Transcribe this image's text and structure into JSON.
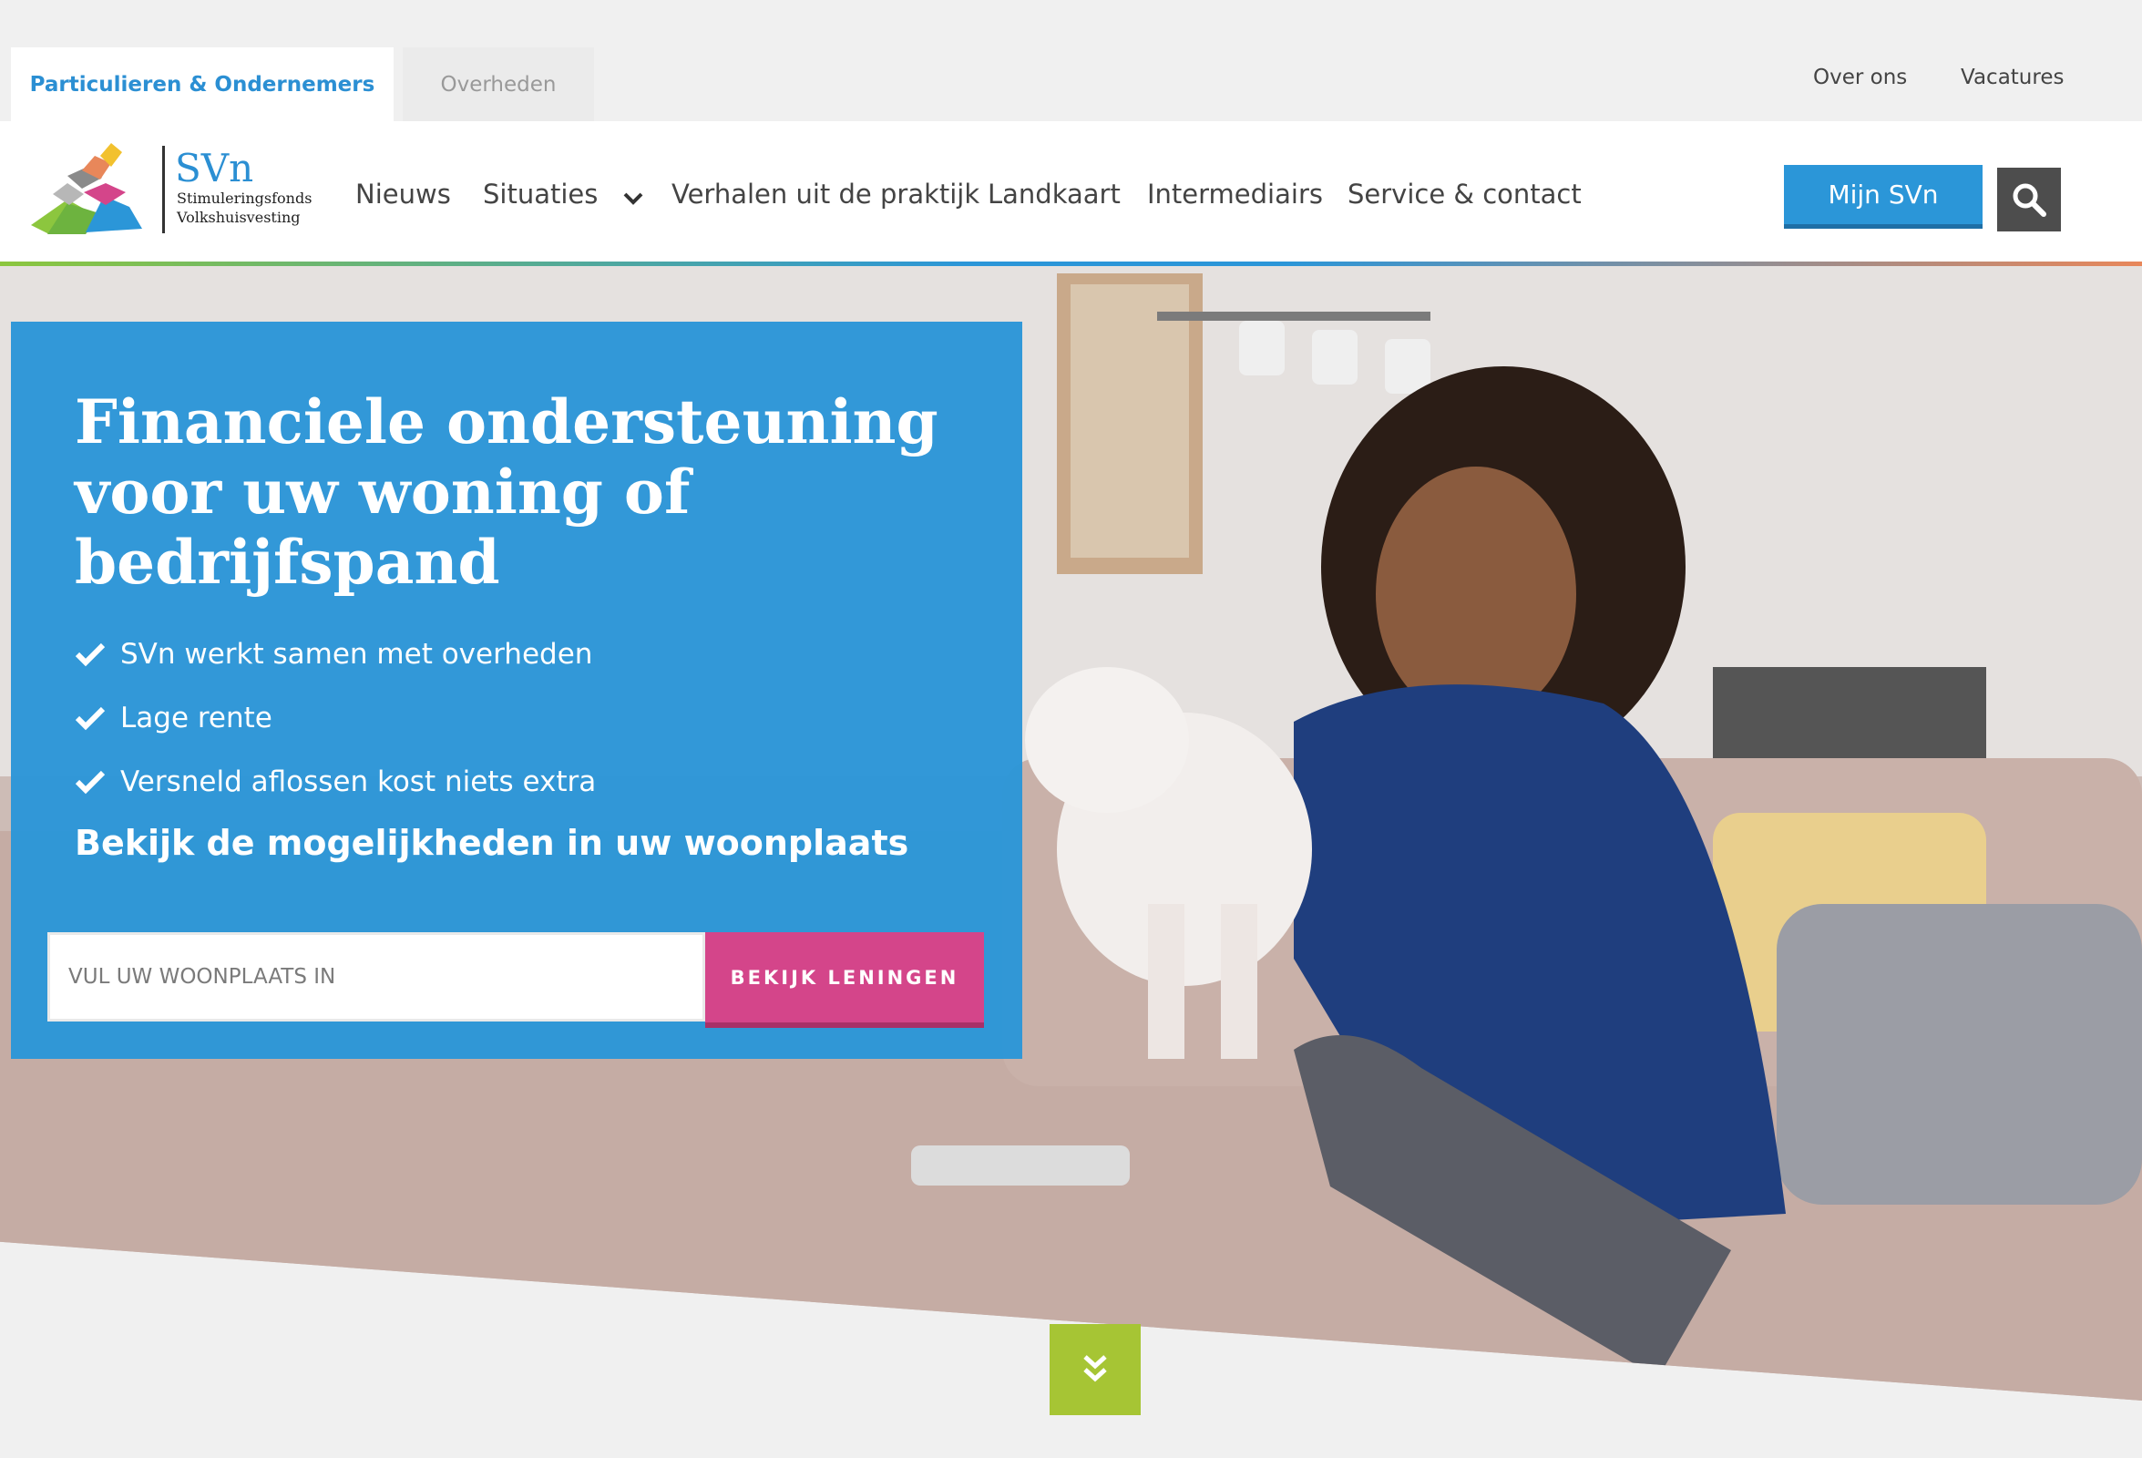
{
  "top_tabs": [
    {
      "label": "Particulieren & Ondernemers",
      "active": true
    },
    {
      "label": "Overheden",
      "active": false
    }
  ],
  "top_links": [
    "Over ons",
    "Vacatures"
  ],
  "logo": {
    "name": "SVn",
    "sub_line1": "Stimuleringsfonds",
    "sub_line2": "Volkshuisvesting"
  },
  "nav": [
    "Nieuws",
    "Situaties",
    "Verhalen uit de praktijk",
    "Landkaart",
    "Intermediairs",
    "Service & contact"
  ],
  "header": {
    "mijn_label": "Mijn SVn",
    "search_icon": "search-icon"
  },
  "promo": {
    "title": "Financiele ondersteuning voor uw woning of bedrijfspand",
    "checks": [
      "SVn werkt samen met overheden",
      "Lage rente",
      "Versneld aflossen kost niets extra"
    ],
    "subtitle": "Bekijk de mogelijkheden in uw woonplaats",
    "input_placeholder": "VUL UW WOONPLAATS IN",
    "button_label": "BEKIJK LENINGEN"
  },
  "colors": {
    "brand_blue": "#2b96d8",
    "pink": "#d4458a",
    "green": "#a6c534",
    "dark": "#4d4d4d"
  }
}
